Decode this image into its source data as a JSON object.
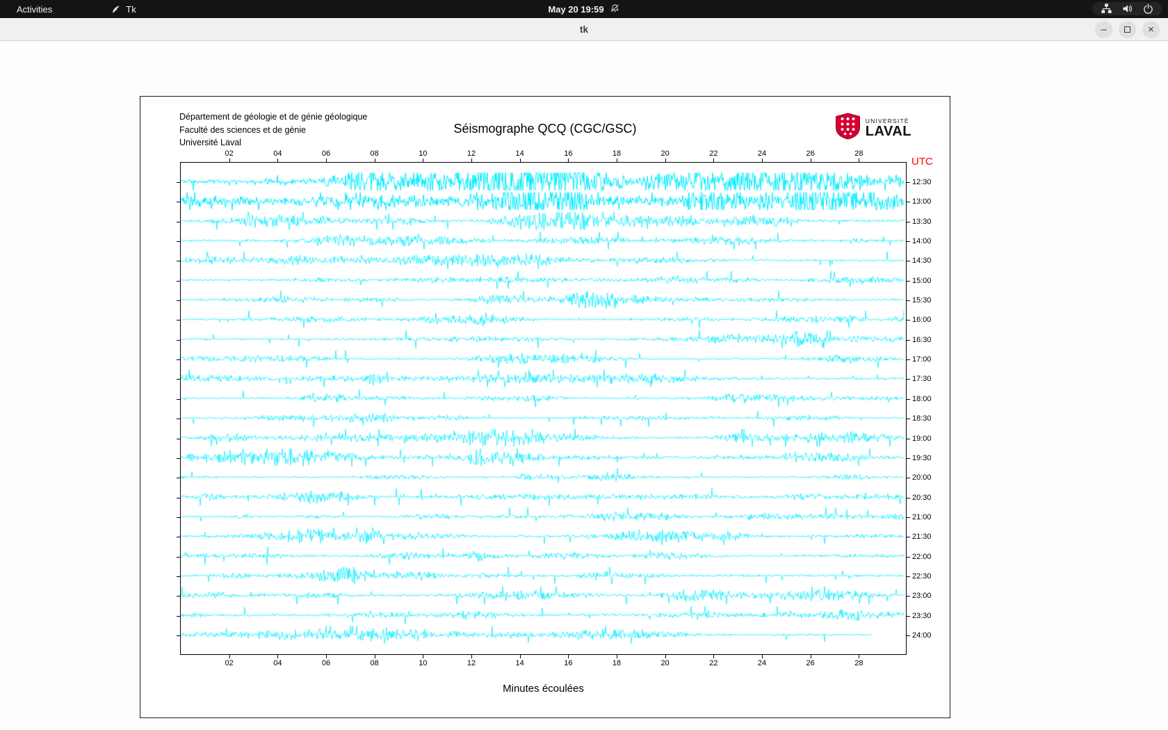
{
  "topbar": {
    "activities": "Activities",
    "app_name": "Tk",
    "clock": "May 20 19:59",
    "tray": [
      "network-icon",
      "volume-icon",
      "power-icon"
    ]
  },
  "window": {
    "title": "tk",
    "controls": {
      "minimize": "–",
      "maximize": "",
      "close": "×"
    }
  },
  "seismograph": {
    "header_lines": [
      "Département de géologie et de génie géologique",
      "Faculté des sciences et de génie",
      "Université Laval"
    ],
    "title": "Séismographe QCQ (CGC/GSC)",
    "logo": {
      "top": "UNIVERSITÉ",
      "bottom": "LAVAL",
      "shield_color": "#d50032"
    },
    "utc_label": "UTC",
    "xlabel": "Minutes écoulées",
    "x_ticks": [
      "02",
      "04",
      "06",
      "08",
      "10",
      "12",
      "14",
      "16",
      "18",
      "20",
      "22",
      "24",
      "26",
      "28"
    ],
    "row_labels": [
      "12:30",
      "13:00",
      "13:30",
      "14:00",
      "14:30",
      "15:00",
      "15:30",
      "16:00",
      "16:30",
      "17:00",
      "17:30",
      "18:00",
      "18:30",
      "19:00",
      "19:30",
      "20:00",
      "20:30",
      "21:00",
      "21:30",
      "22:00",
      "22:30",
      "23:00",
      "23:30",
      "24:00"
    ],
    "trace_color": "#00ecff"
  },
  "chart_data": {
    "type": "line",
    "subtype": "seismogram-helicorder",
    "title": "Séismographe QCQ (CGC/GSC)",
    "xlabel": "Minutes écoulées",
    "x_axis": {
      "range_minutes": [
        0,
        30
      ],
      "ticks": [
        2,
        4,
        6,
        8,
        10,
        12,
        14,
        16,
        18,
        20,
        22,
        24,
        26,
        28
      ]
    },
    "right_axis_label": "UTC",
    "row_start_times_utc": [
      "12:30",
      "13:00",
      "13:30",
      "14:00",
      "14:30",
      "15:00",
      "15:30",
      "16:00",
      "16:30",
      "17:00",
      "17:30",
      "18:00",
      "18:30",
      "19:00",
      "19:30",
      "20:00",
      "20:30",
      "21:00",
      "21:30",
      "22:00",
      "22:30",
      "23:00",
      "23:30",
      "24:00"
    ],
    "rows": 24,
    "minutes_per_row": 30,
    "legend": "none",
    "grid": false,
    "note": "Continuous seismic background noise with intermittent small spikes on each half-hour trace; final 24:00 trace is partial (ends near minute 28.5)."
  }
}
